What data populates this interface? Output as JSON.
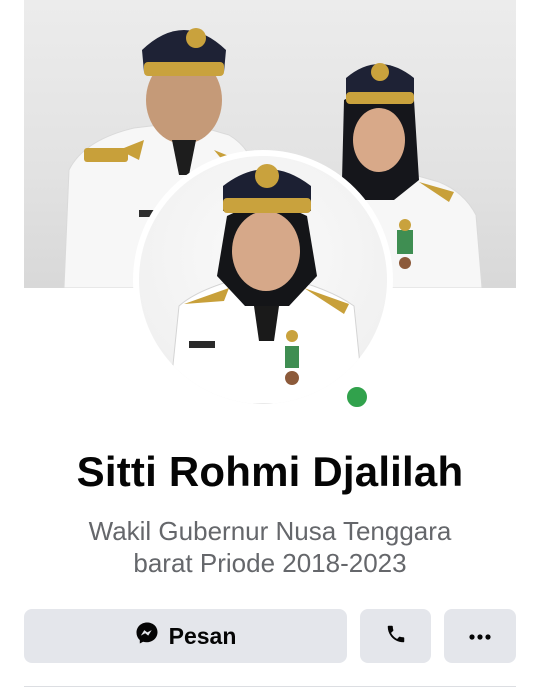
{
  "profile": {
    "name": "Sitti Rohmi Djalilah",
    "bio_line1": "Wakil Gubernur Nusa Tenggara",
    "bio_line2": "barat Priode 2018-2023",
    "online_status_color": "#31a24c"
  },
  "actions": {
    "message_label": "Pesan",
    "message_icon": "messenger-icon",
    "call_icon": "phone-icon",
    "more_icon": "more-horizontal-icon"
  },
  "colors": {
    "button_bg": "#e4e6eb",
    "text_primary": "#050505",
    "text_secondary": "#65676b"
  }
}
